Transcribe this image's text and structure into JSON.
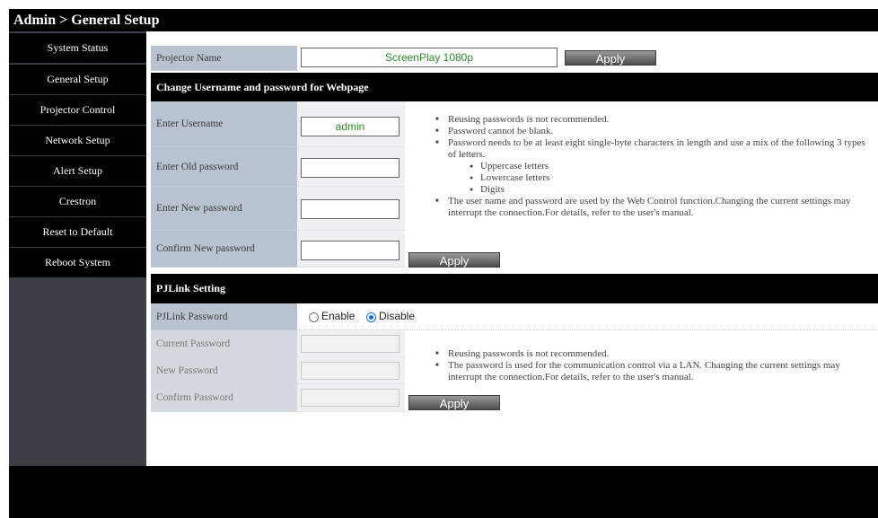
{
  "title": "Admin > General Setup",
  "sidebar": {
    "items": [
      {
        "label": "System Status"
      },
      {
        "label": "General Setup"
      },
      {
        "label": "Projector Control"
      },
      {
        "label": "Network Setup"
      },
      {
        "label": "Alert Setup"
      },
      {
        "label": "Crestron"
      },
      {
        "label": "Reset to Default"
      },
      {
        "label": "Reboot System"
      }
    ]
  },
  "projector": {
    "label": "Projector Name",
    "value": "ScreenPlay 1080p",
    "apply_label": "Apply"
  },
  "webpage": {
    "section_title": "Change Username and password for Webpage",
    "username_label": "Enter Username",
    "username_value": "admin",
    "old_pw_label": "Enter Old password",
    "new_pw_label": "Enter New password",
    "confirm_pw_label": "Confirm New password",
    "apply_label": "Apply",
    "notes": [
      "Reusing passwords is not recommended.",
      "Password cannot be blank.",
      "Password needs to be at least eight single-byte characters in length and use a mix of the following 3 types of letters."
    ],
    "letter_types": [
      "Uppercase letters",
      "Lowercase letters",
      "Digits"
    ],
    "note_last": "The user name and password are used by the Web Control function.Changing the current settings may interrupt the connection.For details, refer to the user's manual."
  },
  "pjlink": {
    "section_title": "PJLink Setting",
    "password_label": "PJLink Password",
    "enable_label": "Enable",
    "disable_label": "Disable",
    "selected": "Disable",
    "current_label": "Current Password",
    "new_label": "New Password",
    "confirm_label": "Confirm Password",
    "apply_label": "Apply",
    "notes": [
      "Reusing passwords is not recommended.",
      "The password is used for the communication control via a LAN. Changing the current settings may interrupt the connection.For details, refer to the user's manual."
    ]
  },
  "colors": {
    "accent_text": "#2a8a2a",
    "radio_selected": "#1a73e8"
  }
}
